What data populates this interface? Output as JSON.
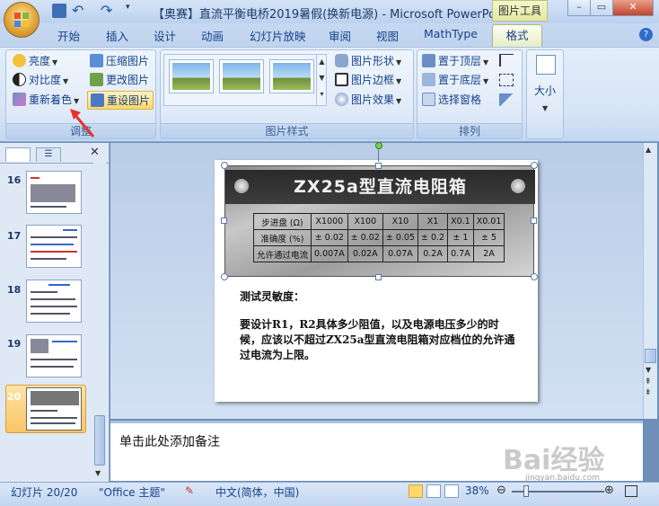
{
  "window": {
    "title": "【奥赛】直流平衡电桥2019暑假(换新电源) - Microsoft PowerPo...",
    "context_tab_title": "图片工具",
    "minimize": "–",
    "restore": "▭",
    "close": "✕"
  },
  "tabs": [
    "开始",
    "插入",
    "设计",
    "动画",
    "幻灯片放映",
    "审阅",
    "视图",
    "MathType",
    "格式"
  ],
  "active_tab": "格式",
  "ribbon": {
    "adjust": {
      "label": "调整",
      "brightness": "亮度",
      "contrast": "对比度",
      "recolor": "重新着色",
      "compress": "压缩图片",
      "change_picture": "更改图片",
      "reset_picture": "重设图片"
    },
    "styles": {
      "label": "图片样式",
      "shape": "图片形状",
      "border": "图片边框",
      "effects": "图片效果"
    },
    "arrange": {
      "label": "排列",
      "bring_front": "置于顶层",
      "send_back": "置于底层",
      "selection_pane": "选择窗格"
    },
    "size": {
      "label": "大小"
    }
  },
  "slides": [
    {
      "num": "16"
    },
    {
      "num": "17"
    },
    {
      "num": "18"
    },
    {
      "num": "19"
    },
    {
      "num": "20"
    }
  ],
  "nameplate": {
    "title": "ZX25a型直流电阻箱",
    "rows": [
      [
        "步进盘 (Ω)",
        "X1000",
        "X100",
        "X10",
        "X1",
        "X0.1",
        "X0.01"
      ],
      [
        "准确度 (%)",
        "± 0.02",
        "± 0.02",
        "± 0.05",
        "± 0.2",
        "± 1",
        "± 5"
      ],
      [
        "允许通过电流",
        "0.007A",
        "0.02A",
        "0.07A",
        "0.2A",
        "0.7A",
        "2A"
      ]
    ]
  },
  "slide_text": {
    "heading": "测试灵敏度：",
    "body": "要设计R1，R2具体多少阻值，以及电源电压多少的时候，应该以不超过ZX25a型直流电阻箱对应档位的允许通过电流为上限。"
  },
  "notes_placeholder": "单击此处添加备注",
  "status": {
    "slide_indicator": "幻灯片 20/20",
    "theme": "\"Office 主题\"",
    "language": "中文(简体，中国)",
    "zoom": "38%"
  },
  "watermark": {
    "text": "Bai经验",
    "sub": "jingyan.baidu.com"
  },
  "colors": {
    "accent": "#15428b",
    "ribbon_bg": "#d6e4f6",
    "selected_thumb": "#fbc564",
    "arrow": "#e8322b"
  }
}
